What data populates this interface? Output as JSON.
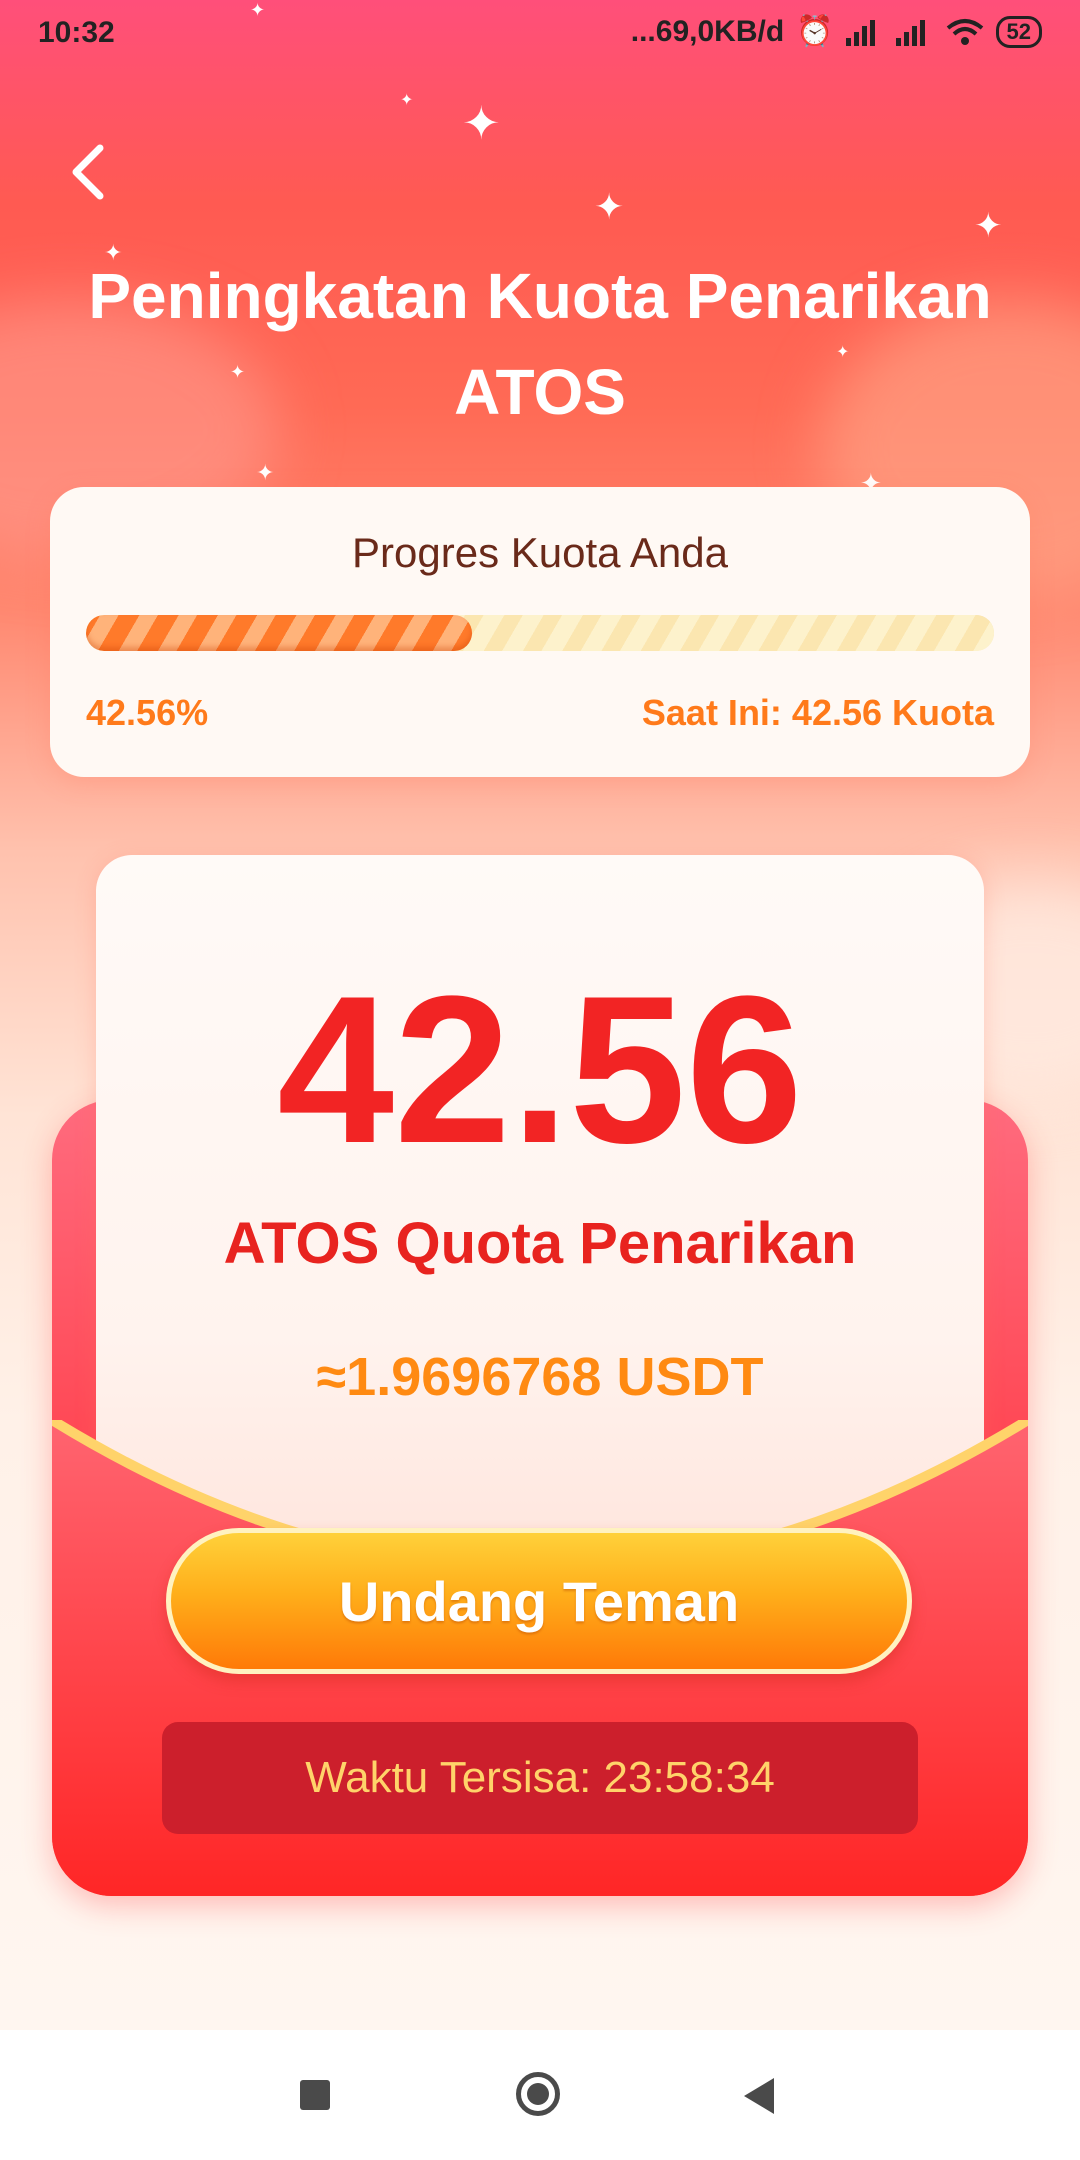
{
  "status_bar": {
    "time": "10:32",
    "network_speed": "...69,0KB/d",
    "battery": "52",
    "icons": [
      "alarm-icon",
      "signal-icon",
      "signal-icon",
      "wifi-icon",
      "battery-icon"
    ]
  },
  "header": {
    "back_icon": "chevron-left-icon",
    "title_line1": "Peningkatan Kuota Penarikan",
    "title_line2": "ATOS"
  },
  "progress_card": {
    "label": "Progres Kuota Anda",
    "percent_text": "42.56%",
    "progress_fraction": 0.4256,
    "current_text": "Saat Ini: 42.56 Kuota"
  },
  "quota_card": {
    "amount": "42.56",
    "subtitle": "ATOS Quota Penarikan",
    "usdt": "≈1.9696768 USDT"
  },
  "invite_button": {
    "label": "Undang Teman"
  },
  "timer": {
    "text": "Waktu Tersisa: 23:58:34"
  },
  "colors": {
    "accent_red": "#f22424",
    "accent_orange": "#ff8a12",
    "button_yellow": "#ffae1a",
    "timer_bg": "#cc1f2c"
  },
  "nav_bar": {
    "icons": [
      "recent-apps-icon",
      "home-icon",
      "back-triangle-icon"
    ]
  }
}
